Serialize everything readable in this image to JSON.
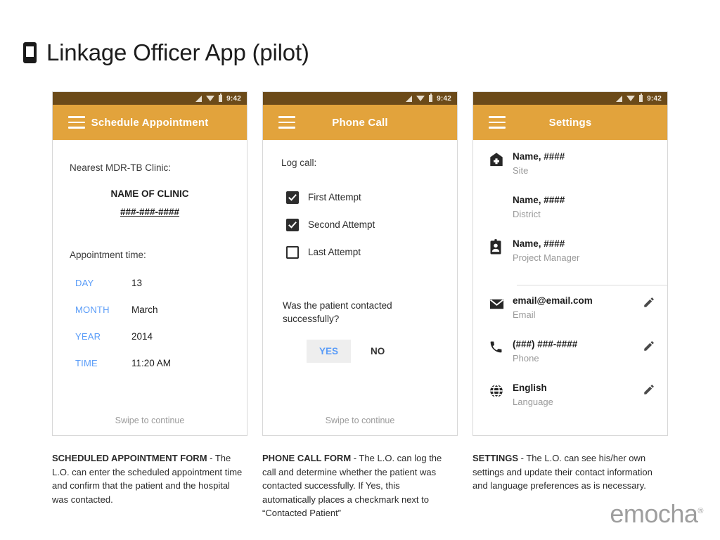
{
  "page": {
    "title": "Linkage Officer App (pilot)",
    "title_icon": "smartphone-icon",
    "logo": "emocha",
    "logo_mark": "®",
    "accent_color": "#E2A33C",
    "statusbar_color": "#6B4A19",
    "link_color": "#5A9CF8"
  },
  "screens": [
    {
      "id": "schedule",
      "status_time": "9:42",
      "menu_icon": "hamburger-icon",
      "app_bar_title": "Schedule Appointment",
      "clinic_label": "Nearest MDR-TB Clinic:",
      "clinic_name": "NAME OF CLINIC",
      "clinic_phone": "###-###-####",
      "appointment_label": "Appointment time:",
      "fields": [
        {
          "key": "DAY",
          "value": "13"
        },
        {
          "key": "MONTH",
          "value": "March"
        },
        {
          "key": "YEAR",
          "value": "2014"
        },
        {
          "key": "TIME",
          "value": "11:20 AM"
        }
      ],
      "footer": "Swipe to continue",
      "caption_bold": "SCHEDULED APPOINTMENT FORM",
      "caption_rest": " - The L.O. can enter the scheduled appointment time and confirm that the patient and the hospital was contacted."
    },
    {
      "id": "phone-call",
      "status_time": "9:42",
      "menu_icon": "hamburger-icon",
      "app_bar_title": "Phone Call",
      "log_label": "Log call:",
      "checkboxes": [
        {
          "label": "First Attempt",
          "checked": true
        },
        {
          "label": "Second Attempt",
          "checked": true
        },
        {
          "label": "Last Attempt",
          "checked": false
        }
      ],
      "question": "Was the patient contacted successfully?",
      "answer_yes": "YES",
      "answer_no": "NO",
      "answer_selected": "YES",
      "footer": "Swipe to continue",
      "caption_bold": "PHONE CALL FORM",
      "caption_rest": " - The L.O. can log the call and determine whether the patient was contacted successfully. If Yes, this automatically places a checkmark next to “Contacted Patient”"
    },
    {
      "id": "settings",
      "status_time": "9:42",
      "menu_icon": "hamburger-icon",
      "app_bar_title": "Settings",
      "items": [
        {
          "icon": "hospital-icon",
          "value": "Name, ####",
          "sub": "Site",
          "edit": false
        },
        {
          "icon": "none",
          "value": "Name, ####",
          "sub": "District",
          "edit": false
        },
        {
          "icon": "id-badge-icon",
          "value": "Name, ####",
          "sub": "Project Manager",
          "edit": false
        },
        {
          "icon": "mail-icon",
          "value": "email@email.com",
          "sub": "Email",
          "edit": true
        },
        {
          "icon": "phone-icon",
          "value": "(###) ###-####",
          "sub": "Phone",
          "edit": true
        },
        {
          "icon": "globe-icon",
          "value": "English",
          "sub": "Language",
          "edit": true
        }
      ],
      "caption_bold": "SETTINGS",
      "caption_rest": " - The L.O. can see his/her own settings and update their contact information and language preferences as is necessary."
    }
  ]
}
